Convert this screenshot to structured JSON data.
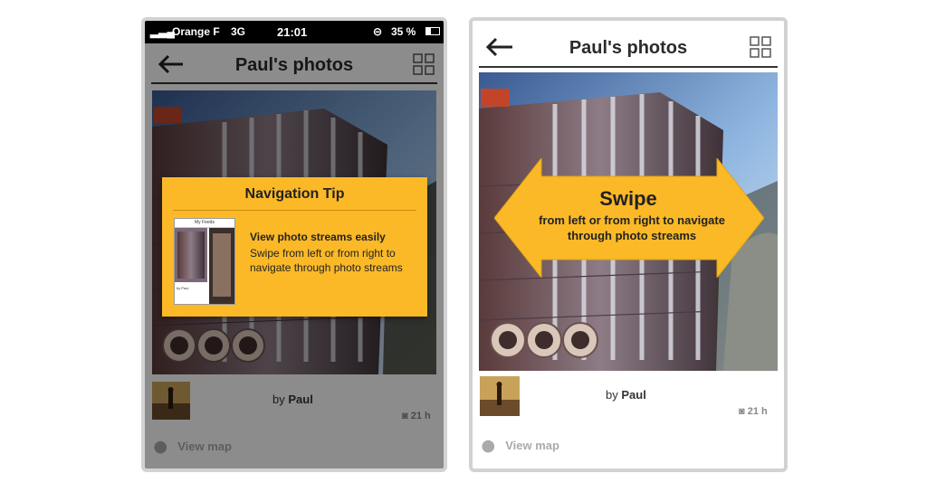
{
  "left_screen": {
    "status_bar": {
      "carrier": "Orange F",
      "network": "3G",
      "time": "21:01",
      "battery": "35 %"
    },
    "nav": {
      "title": "Paul's photos"
    },
    "tip": {
      "title": "Navigation Tip",
      "thumb_title": "My Feeds",
      "thumb_caption": "by Paul",
      "heading": "View photo streams easily",
      "body": "Swipe from left or from right to navigate through photo streams"
    },
    "meta": {
      "by_prefix": "by",
      "author": "Paul",
      "age": "21 h",
      "view_map": "View map"
    }
  },
  "right_screen": {
    "nav": {
      "title": "Paul's photos"
    },
    "swipe": {
      "title": "Swipe",
      "body": "from left or from right to navigate through photo streams"
    },
    "meta": {
      "by_prefix": "by",
      "author": "Paul",
      "age": "21 h",
      "view_map": "View map"
    }
  },
  "colors": {
    "accent": "#fbb927",
    "frame": "#d2d2d2",
    "text": "#2b2b2b"
  }
}
